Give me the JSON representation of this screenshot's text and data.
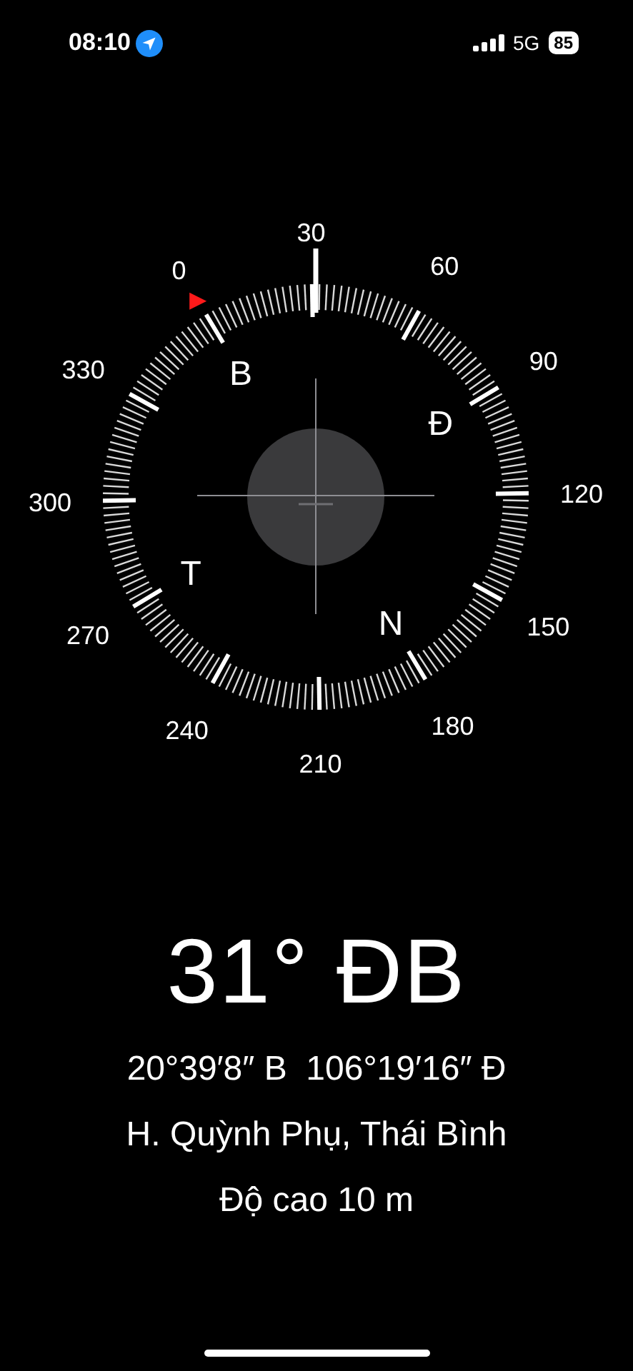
{
  "status_bar": {
    "time": "08:10",
    "network": "5G",
    "battery": "85"
  },
  "compass": {
    "degree_labels": [
      "0",
      "30",
      "60",
      "90",
      "120",
      "150",
      "180",
      "210",
      "240",
      "270",
      "300",
      "330"
    ],
    "cardinals": [
      "B",
      "Đ",
      "N",
      "T"
    ]
  },
  "heading": "31° ĐB",
  "coordinates": "20°39′8″ B  106°19′16″ Đ",
  "place": "H. Quỳnh Phụ, Thái Bình",
  "altitude": "Độ cao 10 m"
}
